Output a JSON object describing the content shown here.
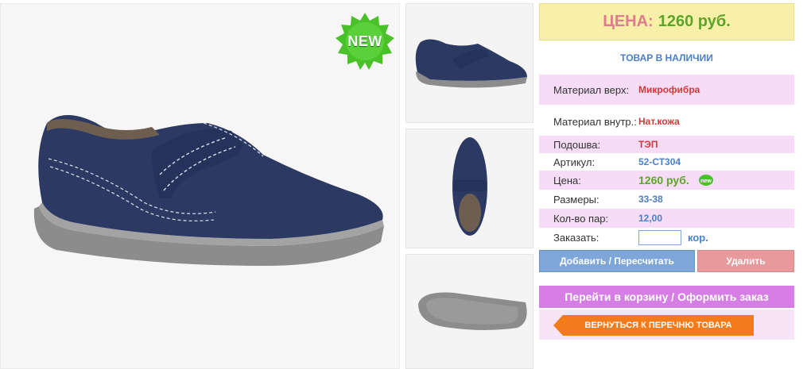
{
  "badge": {
    "new_label": "NEW",
    "mini_new_label": "new"
  },
  "price_box": {
    "label": "ЦЕНА:",
    "value": "1260 руб."
  },
  "stock_status": "ТОВАР В НАЛИЧИИ",
  "specs": [
    {
      "key": "Материал верх:",
      "value": "Микрофибра"
    },
    {
      "key": "Материал внутр.:",
      "value": "Нат.кожа"
    },
    {
      "key": "Подошва:",
      "value": "ТЭП"
    },
    {
      "key": "Артикул:",
      "value": "52-СТ304"
    },
    {
      "key": "Цена:",
      "value": "1260 руб."
    },
    {
      "key": "Размеры:",
      "value": "33-38"
    },
    {
      "key": "Кол-во пар:",
      "value": "12,00"
    }
  ],
  "order": {
    "label": "Заказать:",
    "value": "",
    "unit": "кор."
  },
  "buttons": {
    "add": "Добавить / Пересчитать",
    "delete": "Удалить",
    "cart": "Перейти в корзину / Оформить заказ",
    "back": "ВЕРНУТЬСЯ К ПЕРЕЧНЮ ТОВАРА"
  },
  "colors": {
    "price_bg": "#f8f0a8",
    "accent_blue": "#4b7fc6",
    "accent_green": "#5ca52a",
    "accent_red": "#d03a3a",
    "row_pink": "#f6dcf6",
    "cart_purple": "#d77ee6",
    "back_orange": "#f47a1a",
    "shoe_navy": "#2c3a63",
    "sole_gray": "#8c8c8c"
  },
  "icons": [
    "new-badge-icon",
    "left-arrow-icon"
  ]
}
